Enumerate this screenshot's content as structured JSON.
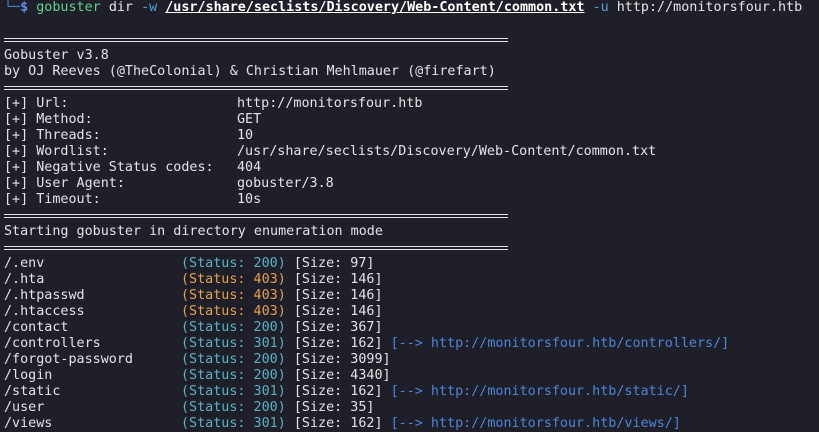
{
  "prompt": {
    "glyph": "└─",
    "dollar": "$",
    "binary": "gobuster",
    "subcommand": "dir",
    "wordlist_flag": "-w",
    "wordlist_path": "/usr/share/seclists/Discovery/Web-Content/common.txt",
    "url_flag": "-u",
    "url": "http://monitorsfour.htb"
  },
  "banner": {
    "version_line": "Gobuster v3.8",
    "authors_line": "by OJ Reeves (@TheColonial) & Christian Mehlmauer (@firefart)"
  },
  "config": [
    {
      "key": "[+] Url:",
      "value": "http://monitorsfour.htb"
    },
    {
      "key": "[+] Method:",
      "value": "GET"
    },
    {
      "key": "[+] Threads:",
      "value": "10"
    },
    {
      "key": "[+] Wordlist:",
      "value": "/usr/share/seclists/Discovery/Web-Content/common.txt"
    },
    {
      "key": "[+] Negative Status codes:",
      "value": "404"
    },
    {
      "key": "[+] User Agent:",
      "value": "gobuster/3.8"
    },
    {
      "key": "[+] Timeout:",
      "value": "10s"
    }
  ],
  "mode_line": "Starting gobuster in directory enumeration mode",
  "results": [
    {
      "path": "/.env",
      "status": "(Status: 200)",
      "code": "200",
      "size": "[Size: 97]",
      "redirect": ""
    },
    {
      "path": "/.hta",
      "status": "(Status: 403)",
      "code": "403",
      "size": "[Size: 146]",
      "redirect": ""
    },
    {
      "path": "/.htpasswd",
      "status": "(Status: 403)",
      "code": "403",
      "size": "[Size: 146]",
      "redirect": ""
    },
    {
      "path": "/.htaccess",
      "status": "(Status: 403)",
      "code": "403",
      "size": "[Size: 146]",
      "redirect": ""
    },
    {
      "path": "/contact",
      "status": "(Status: 200)",
      "code": "200",
      "size": "[Size: 367]",
      "redirect": ""
    },
    {
      "path": "/controllers",
      "status": "(Status: 301)",
      "code": "301",
      "size": "[Size: 162]",
      "redirect": "[--> http://monitorsfour.htb/controllers/]"
    },
    {
      "path": "/forgot-password",
      "status": "(Status: 200)",
      "code": "200",
      "size": "[Size: 3099]",
      "redirect": ""
    },
    {
      "path": "/login",
      "status": "(Status: 200)",
      "code": "200",
      "size": "[Size: 4340]",
      "redirect": ""
    },
    {
      "path": "/static",
      "status": "(Status: 301)",
      "code": "301",
      "size": "[Size: 162]",
      "redirect": "[--> http://monitorsfour.htb/static/]"
    },
    {
      "path": "/user",
      "status": "(Status: 200)",
      "code": "200",
      "size": "[Size: 35]",
      "redirect": ""
    },
    {
      "path": "/views",
      "status": "(Status: 301)",
      "code": "301",
      "size": "[Size: 162]",
      "redirect": "[--> http://monitorsfour.htb/views/]"
    }
  ],
  "colors": {
    "background": "#1e1f29",
    "status_ok": "#5ab4c8",
    "status_forbidden": "#e5a14e",
    "redirect": "#4e86d9",
    "command": "#5fd38d"
  }
}
